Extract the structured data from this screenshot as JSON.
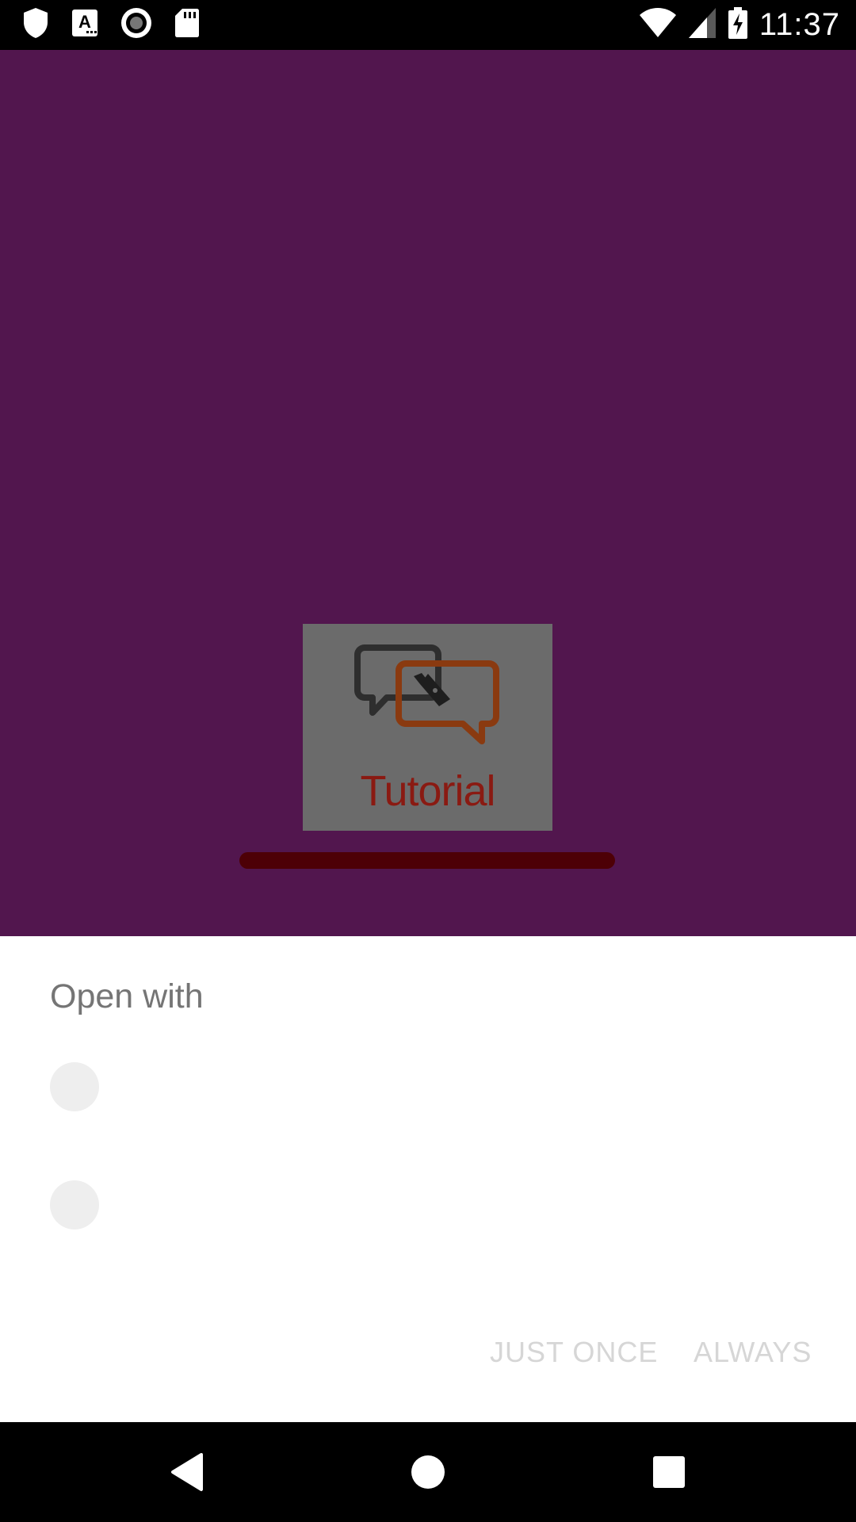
{
  "status_bar": {
    "time": "11:37",
    "left_icons": [
      "shield-icon",
      "accessibility-a-icon",
      "record-icon",
      "sd-card-icon"
    ],
    "right_icons": [
      "wifi-icon",
      "cell-signal-icon",
      "battery-charging-icon"
    ]
  },
  "app": {
    "background_color": "#52164e",
    "logo": {
      "text": "Tutorial",
      "icon": "chat-bubbles-pen-icon"
    },
    "progress_bar_color": "#4d0006"
  },
  "dialog": {
    "title": "Open with",
    "apps": [
      {
        "label": "",
        "icon": "placeholder-app-icon"
      },
      {
        "label": "",
        "icon": "placeholder-app-icon"
      }
    ],
    "buttons": {
      "just_once": "JUST ONCE",
      "always": "ALWAYS"
    }
  },
  "nav_bar": {
    "buttons": [
      "back-icon",
      "home-icon",
      "recents-icon"
    ]
  }
}
